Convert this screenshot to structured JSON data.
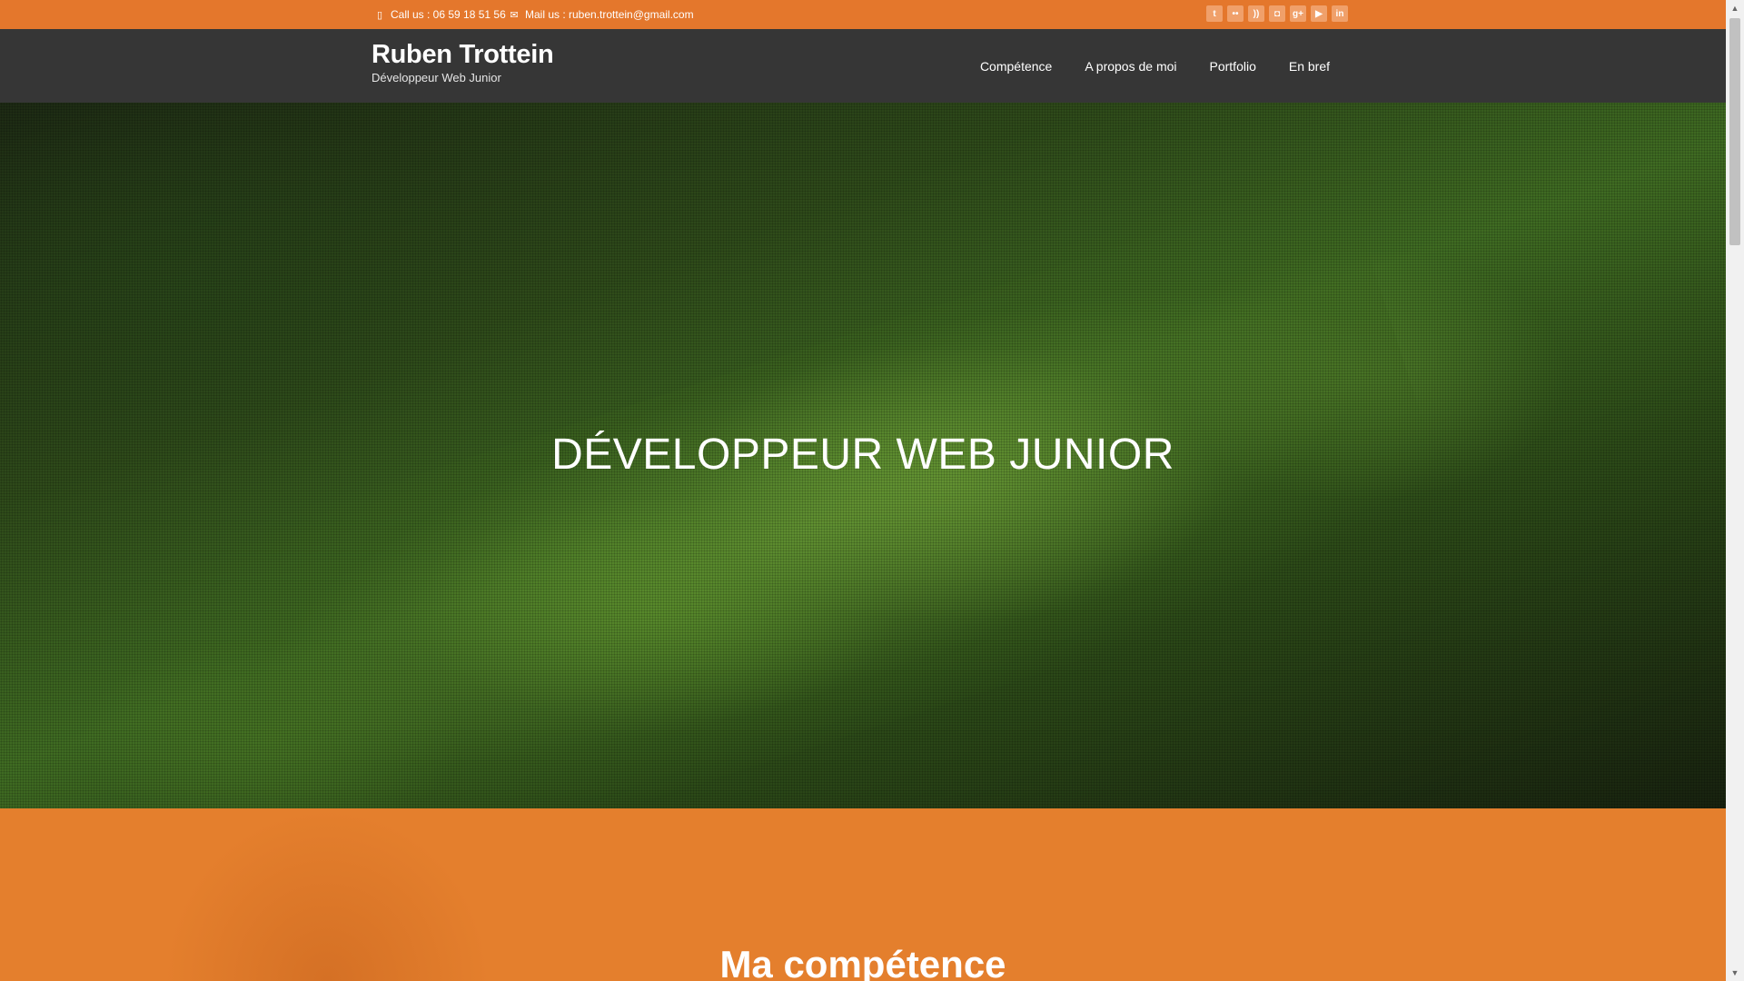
{
  "topbar": {
    "call_label": "Call us : 06 59 18 51 56",
    "mail_label": "Mail us : ruben.trottein@gmail.com",
    "socials": [
      {
        "icon": "twitter-icon",
        "glyph": "t"
      },
      {
        "icon": "flickr-icon",
        "glyph": "••"
      },
      {
        "icon": "rss-icon",
        "glyph": "))"
      },
      {
        "icon": "instagram-icon",
        "glyph": "◘"
      },
      {
        "icon": "google-plus-icon",
        "glyph": "g+"
      },
      {
        "icon": "youtube-icon",
        "glyph": "▶"
      },
      {
        "icon": "linkedin-icon",
        "glyph": "in"
      }
    ]
  },
  "header": {
    "site_name": "Ruben Trottein",
    "tagline": "Développeur Web Junior",
    "nav": [
      {
        "label": "Compétence"
      },
      {
        "label": "A propos de moi"
      },
      {
        "label": "Portfolio"
      },
      {
        "label": "En bref"
      }
    ]
  },
  "hero": {
    "title": "DÉVELOPPEUR WEB JUNIOR"
  },
  "section": {
    "title": "Ma compétence"
  },
  "colors": {
    "accent": "#e4772c",
    "header_bg": "#363636"
  }
}
